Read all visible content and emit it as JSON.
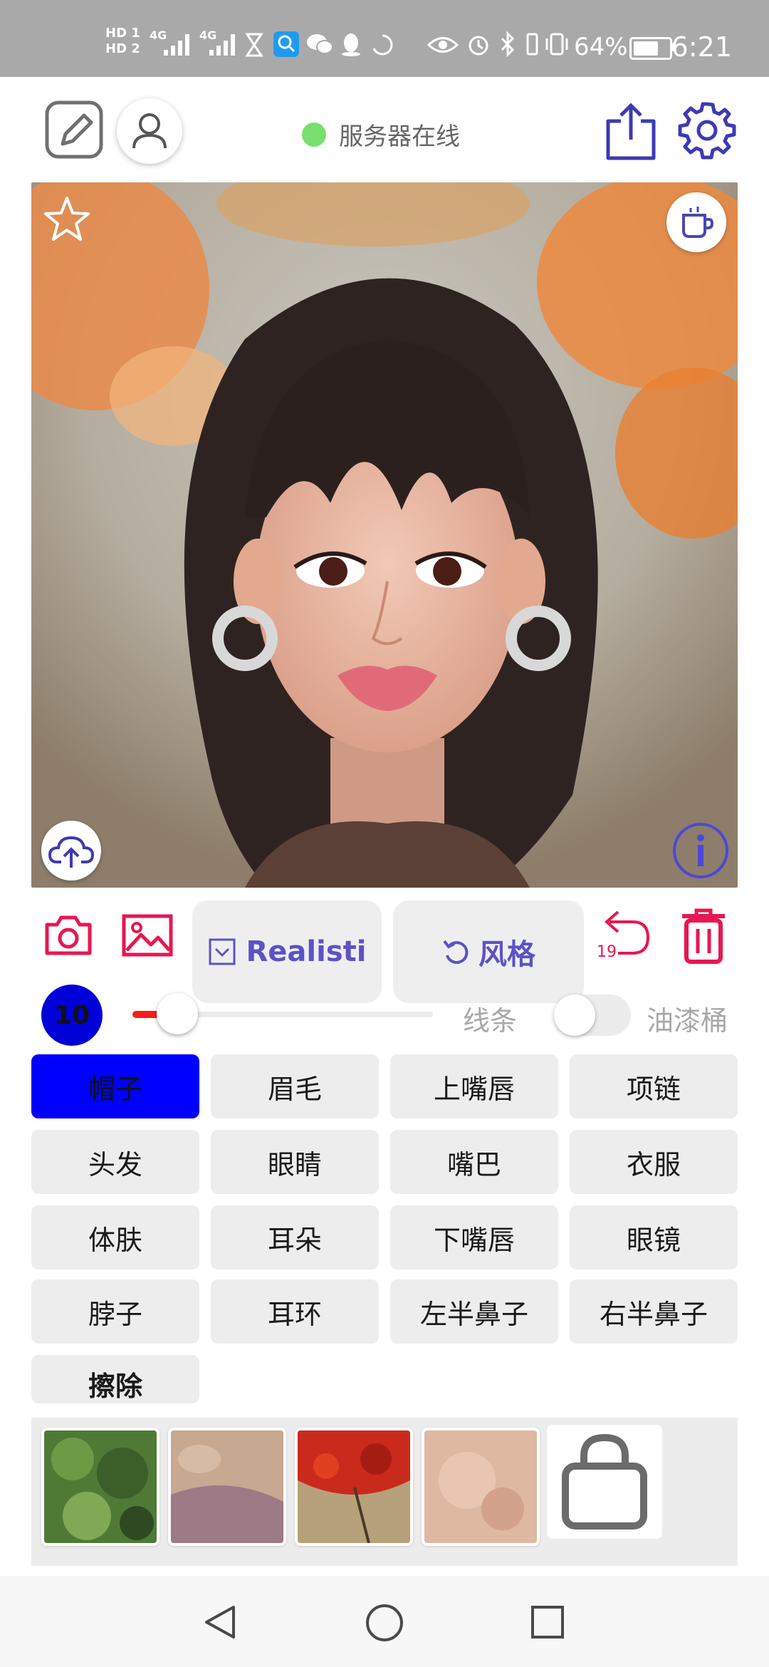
{
  "status_bar": {
    "sim1": "HD 1",
    "sim2": "HD 2",
    "net1": "4G",
    "net2": "4G",
    "battery_percent": "64%",
    "time": "6:21"
  },
  "header": {
    "server_status": "服务器在线",
    "server_status_color": "#78e06e"
  },
  "toolbar": {
    "model_label": "Realisti",
    "style_label": "风格",
    "undo_count": "19",
    "accent_color": "#e8174f",
    "pill_text_color": "#5b52c7"
  },
  "brush": {
    "size": "10",
    "size_fraction": 0.11,
    "line_label": "线条",
    "bucket_label": "油漆桶",
    "bucket_enabled": false
  },
  "parts": {
    "selected": "帽子",
    "items": [
      "帽子",
      "眉毛",
      "上嘴唇",
      "项链",
      "头发",
      "眼睛",
      "嘴巴",
      "衣服",
      "体肤",
      "耳朵",
      "下嘴唇",
      "眼镜",
      "脖子",
      "耳环",
      "左半鼻子",
      "右半鼻子",
      "擦除"
    ]
  },
  "icons": {
    "edit": "edit-icon",
    "user": "user-icon",
    "share": "share-icon",
    "settings": "gear-icon",
    "favorite": "star-icon",
    "coffee": "coffee-icon",
    "upload": "cloud-upload-icon",
    "info": "info-icon",
    "camera": "camera-icon",
    "gallery": "image-icon",
    "undo": "undo-icon",
    "delete": "trash-icon",
    "shop": "shopping-bag-icon"
  }
}
